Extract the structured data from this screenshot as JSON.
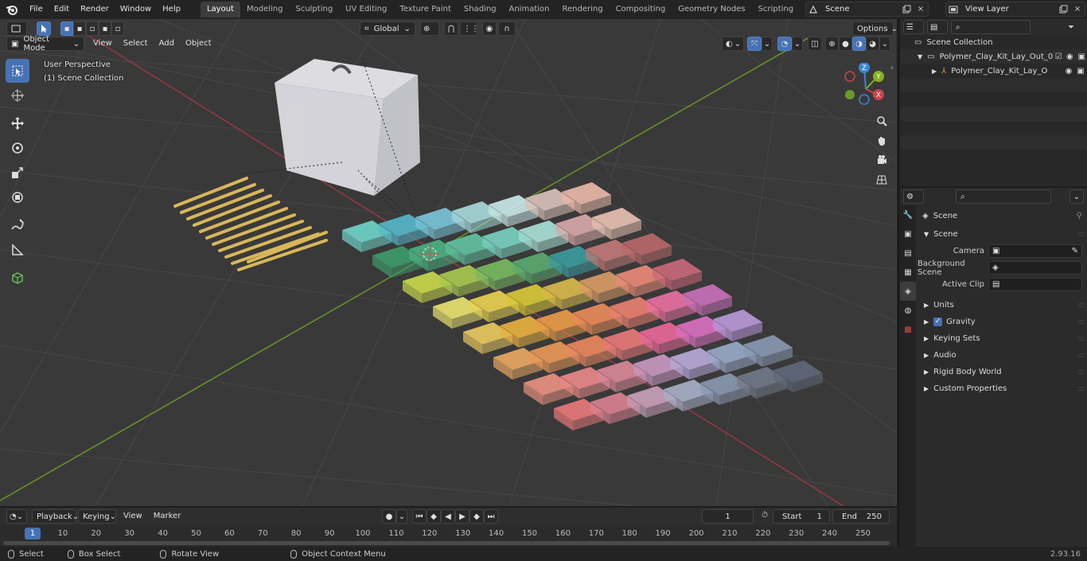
{
  "topbar": {
    "menus": [
      "File",
      "Edit",
      "Render",
      "Window",
      "Help"
    ],
    "workspaces": [
      "Layout",
      "Modeling",
      "Sculpting",
      "UV Editing",
      "Texture Paint",
      "Shading",
      "Animation",
      "Rendering",
      "Compositing",
      "Geometry Nodes",
      "Scripting"
    ],
    "active_workspace": "Layout",
    "scene_name": "Scene",
    "view_layer_name": "View Layer"
  },
  "viewport": {
    "mode": "Object Mode",
    "menus": [
      "View",
      "Select",
      "Add",
      "Object"
    ],
    "transform_orientation": "Global",
    "options_label": "Options",
    "perspective_label": "User Perspective",
    "collection_label": "(1) Scene Collection",
    "gizmo_axes": [
      "X",
      "Y",
      "Z"
    ]
  },
  "outliner": {
    "root": "Scene Collection",
    "items": [
      {
        "label": "Polymer_Clay_Kit_Lay_Out_0",
        "level": 1
      },
      {
        "label": "Polymer_Clay_Kit_Lay_O",
        "level": 2
      }
    ]
  },
  "properties": {
    "context_title": "Scene",
    "section": "Scene",
    "fields": [
      {
        "label": "Camera",
        "value": ""
      },
      {
        "label": "Background Scene",
        "value": ""
      },
      {
        "label": "Active Clip",
        "value": ""
      }
    ],
    "panels": [
      "Units",
      "Gravity",
      "Keying Sets",
      "Audio",
      "Rigid Body World",
      "Custom Properties"
    ],
    "gravity_checked": true
  },
  "timeline": {
    "menus": [
      "Playback",
      "Keying",
      "View",
      "Marker"
    ],
    "current_frame": "1",
    "start_label": "Start",
    "start_value": "1",
    "end_label": "End",
    "end_value": "250",
    "ticks": [
      "10",
      "20",
      "30",
      "40",
      "50",
      "60",
      "70",
      "80",
      "90",
      "100",
      "110",
      "120",
      "130",
      "140",
      "150",
      "160",
      "170",
      "180",
      "190",
      "200",
      "210",
      "220",
      "230",
      "240",
      "250"
    ],
    "cursor_frame": "1"
  },
  "statusbar": {
    "items": [
      "Select",
      "Box Select",
      "Rotate View",
      "Object Context Menu"
    ],
    "version": "2.93.16"
  },
  "colors": {
    "accent": "#4772b3",
    "x_axis": "#c9424f",
    "y_axis": "#86b01f",
    "z_axis": "#3a86d4"
  }
}
